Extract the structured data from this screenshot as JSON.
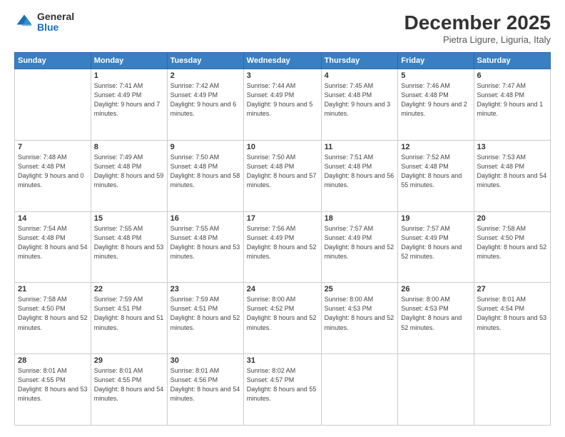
{
  "logo": {
    "general": "General",
    "blue": "Blue"
  },
  "header": {
    "month": "December 2025",
    "location": "Pietra Ligure, Liguria, Italy"
  },
  "days_of_week": [
    "Sunday",
    "Monday",
    "Tuesday",
    "Wednesday",
    "Thursday",
    "Friday",
    "Saturday"
  ],
  "weeks": [
    [
      {
        "day": "",
        "info": ""
      },
      {
        "day": "1",
        "info": "Sunrise: 7:41 AM\nSunset: 4:49 PM\nDaylight: 9 hours\nand 7 minutes."
      },
      {
        "day": "2",
        "info": "Sunrise: 7:42 AM\nSunset: 4:49 PM\nDaylight: 9 hours\nand 6 minutes."
      },
      {
        "day": "3",
        "info": "Sunrise: 7:44 AM\nSunset: 4:49 PM\nDaylight: 9 hours\nand 5 minutes."
      },
      {
        "day": "4",
        "info": "Sunrise: 7:45 AM\nSunset: 4:48 PM\nDaylight: 9 hours\nand 3 minutes."
      },
      {
        "day": "5",
        "info": "Sunrise: 7:46 AM\nSunset: 4:48 PM\nDaylight: 9 hours\nand 2 minutes."
      },
      {
        "day": "6",
        "info": "Sunrise: 7:47 AM\nSunset: 4:48 PM\nDaylight: 9 hours\nand 1 minute."
      }
    ],
    [
      {
        "day": "7",
        "info": "Sunrise: 7:48 AM\nSunset: 4:48 PM\nDaylight: 9 hours\nand 0 minutes."
      },
      {
        "day": "8",
        "info": "Sunrise: 7:49 AM\nSunset: 4:48 PM\nDaylight: 8 hours\nand 59 minutes."
      },
      {
        "day": "9",
        "info": "Sunrise: 7:50 AM\nSunset: 4:48 PM\nDaylight: 8 hours\nand 58 minutes."
      },
      {
        "day": "10",
        "info": "Sunrise: 7:50 AM\nSunset: 4:48 PM\nDaylight: 8 hours\nand 57 minutes."
      },
      {
        "day": "11",
        "info": "Sunrise: 7:51 AM\nSunset: 4:48 PM\nDaylight: 8 hours\nand 56 minutes."
      },
      {
        "day": "12",
        "info": "Sunrise: 7:52 AM\nSunset: 4:48 PM\nDaylight: 8 hours\nand 55 minutes."
      },
      {
        "day": "13",
        "info": "Sunrise: 7:53 AM\nSunset: 4:48 PM\nDaylight: 8 hours\nand 54 minutes."
      }
    ],
    [
      {
        "day": "14",
        "info": "Sunrise: 7:54 AM\nSunset: 4:48 PM\nDaylight: 8 hours\nand 54 minutes."
      },
      {
        "day": "15",
        "info": "Sunrise: 7:55 AM\nSunset: 4:48 PM\nDaylight: 8 hours\nand 53 minutes."
      },
      {
        "day": "16",
        "info": "Sunrise: 7:55 AM\nSunset: 4:48 PM\nDaylight: 8 hours\nand 53 minutes."
      },
      {
        "day": "17",
        "info": "Sunrise: 7:56 AM\nSunset: 4:49 PM\nDaylight: 8 hours\nand 52 minutes."
      },
      {
        "day": "18",
        "info": "Sunrise: 7:57 AM\nSunset: 4:49 PM\nDaylight: 8 hours\nand 52 minutes."
      },
      {
        "day": "19",
        "info": "Sunrise: 7:57 AM\nSunset: 4:49 PM\nDaylight: 8 hours\nand 52 minutes."
      },
      {
        "day": "20",
        "info": "Sunrise: 7:58 AM\nSunset: 4:50 PM\nDaylight: 8 hours\nand 52 minutes."
      }
    ],
    [
      {
        "day": "21",
        "info": "Sunrise: 7:58 AM\nSunset: 4:50 PM\nDaylight: 8 hours\nand 52 minutes."
      },
      {
        "day": "22",
        "info": "Sunrise: 7:59 AM\nSunset: 4:51 PM\nDaylight: 8 hours\nand 51 minutes."
      },
      {
        "day": "23",
        "info": "Sunrise: 7:59 AM\nSunset: 4:51 PM\nDaylight: 8 hours\nand 52 minutes."
      },
      {
        "day": "24",
        "info": "Sunrise: 8:00 AM\nSunset: 4:52 PM\nDaylight: 8 hours\nand 52 minutes."
      },
      {
        "day": "25",
        "info": "Sunrise: 8:00 AM\nSunset: 4:53 PM\nDaylight: 8 hours\nand 52 minutes."
      },
      {
        "day": "26",
        "info": "Sunrise: 8:00 AM\nSunset: 4:53 PM\nDaylight: 8 hours\nand 52 minutes."
      },
      {
        "day": "27",
        "info": "Sunrise: 8:01 AM\nSunset: 4:54 PM\nDaylight: 8 hours\nand 53 minutes."
      }
    ],
    [
      {
        "day": "28",
        "info": "Sunrise: 8:01 AM\nSunset: 4:55 PM\nDaylight: 8 hours\nand 53 minutes."
      },
      {
        "day": "29",
        "info": "Sunrise: 8:01 AM\nSunset: 4:55 PM\nDaylight: 8 hours\nand 54 minutes."
      },
      {
        "day": "30",
        "info": "Sunrise: 8:01 AM\nSunset: 4:56 PM\nDaylight: 8 hours\nand 54 minutes."
      },
      {
        "day": "31",
        "info": "Sunrise: 8:02 AM\nSunset: 4:57 PM\nDaylight: 8 hours\nand 55 minutes."
      },
      {
        "day": "",
        "info": ""
      },
      {
        "day": "",
        "info": ""
      },
      {
        "day": "",
        "info": ""
      }
    ]
  ]
}
